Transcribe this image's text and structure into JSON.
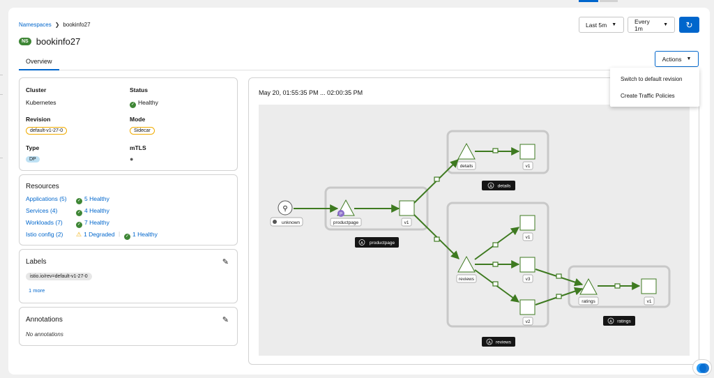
{
  "breadcrumb": {
    "root": "Namespaces",
    "current": "bookinfo27"
  },
  "namespace": {
    "badge": "NS",
    "title": "bookinfo27"
  },
  "tabs": [
    {
      "label": "Overview"
    }
  ],
  "toolbar": {
    "duration": "Last 5m",
    "refresh_interval": "Every 1m",
    "actions_label": "Actions"
  },
  "actions_menu": [
    "Switch to default revision",
    "Create Traffic Policies"
  ],
  "info": {
    "cluster_label": "Cluster",
    "cluster": "Kubernetes",
    "status_label": "Status",
    "status": "Healthy",
    "revision_label": "Revision",
    "revision": "default-v1-27-0",
    "mode_label": "Mode",
    "mode": "Sidecar",
    "type_label": "Type",
    "type": "DP",
    "mtls_label": "mTLS"
  },
  "resources": {
    "title": "Resources",
    "rows": [
      {
        "name": "Applications (5)",
        "health": "5 Healthy"
      },
      {
        "name": "Services (4)",
        "health": "4 Healthy"
      },
      {
        "name": "Workloads (7)",
        "health": "7 Healthy"
      },
      {
        "name": "Istio config (2)",
        "degraded": "1 Degraded",
        "health": "1 Healthy"
      }
    ]
  },
  "labels": {
    "title": "Labels",
    "chip": "istio.io/rev=default-v1-27-0",
    "more": "1 more"
  },
  "annotations": {
    "title": "Annotations",
    "empty": "No annotations"
  },
  "graph": {
    "time_range": "May 20, 01:55:35 PM ... 02:00:35 PM",
    "nodes": {
      "unknown": "unknown",
      "productpage": "productpage",
      "productpage_v1": "v1",
      "details": "details",
      "details_v1": "v1",
      "reviews": "reviews",
      "reviews_v1": "v1",
      "reviews_v3": "v3",
      "reviews_v2": "v2",
      "ratings": "ratings",
      "ratings_v1": "v1"
    },
    "apps": {
      "details": "details",
      "productpage": "productpage",
      "reviews": "reviews",
      "ratings": "ratings"
    },
    "app_badge": "A",
    "productpage_badge": "P",
    "edge_color": "#3e7a20",
    "box_color": "#c8c8c8"
  },
  "colors": {
    "accent": "#0066cc",
    "healthy": "#3e8635",
    "warning": "#f0ab00"
  }
}
